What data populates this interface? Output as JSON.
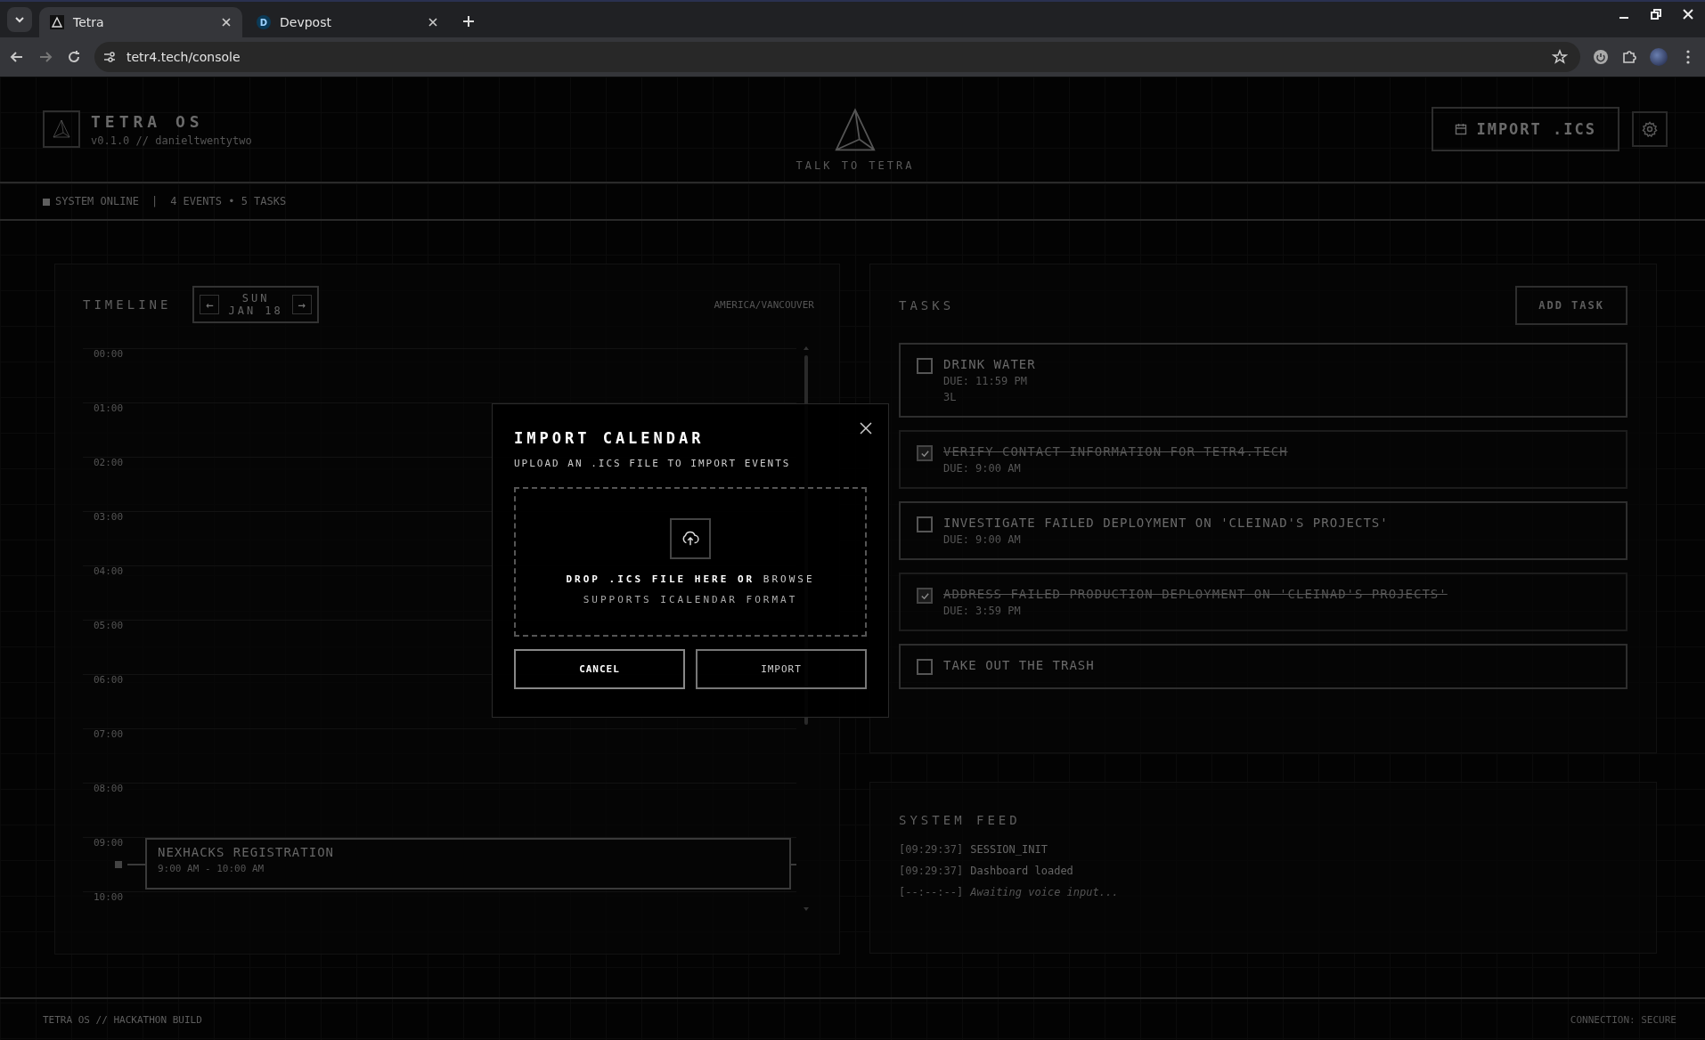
{
  "browser": {
    "tabs": [
      {
        "title": "Tetra",
        "kind": "triangle",
        "selected": true
      },
      {
        "title": "Devpost",
        "kind": "letter",
        "letter": "D",
        "selected": false
      }
    ],
    "url": "tetr4.tech/console"
  },
  "header": {
    "title": "TETRA OS",
    "subtitle": "v0.1.0 // danieltwentytwo",
    "center_label": "TALK TO TETRA",
    "import_button": "IMPORT .ICS"
  },
  "status": {
    "online": "SYSTEM ONLINE",
    "separator": "|",
    "counts": "4 EVENTS • 5 TASKS"
  },
  "timeline": {
    "title": "TIMELINE",
    "day": "SUN",
    "date": "JAN 18",
    "prev": "←",
    "next": "→",
    "timezone": "AMERICA/VANCOUVER",
    "hours": [
      {
        "label": "00:00"
      },
      {
        "label": "01:00"
      },
      {
        "label": "02:00"
      },
      {
        "label": "03:00"
      },
      {
        "label": "04:00"
      },
      {
        "label": "05:00"
      },
      {
        "label": "06:00"
      },
      {
        "label": "07:00"
      },
      {
        "label": "08:00"
      },
      {
        "label": "09:00",
        "events": [
          {
            "title": "NEXHACKS REGISTRATION",
            "time": "9:00 AM - 10:00 AM"
          }
        ]
      },
      {
        "label": "10:00"
      }
    ]
  },
  "tasks": {
    "title": "TASKS",
    "add_button": "ADD TASK",
    "items": [
      {
        "title": "DRINK WATER",
        "due": "DUE: 11:59 PM",
        "note": "3L",
        "checked": false
      },
      {
        "title": "VERIFY CONTACT INFORMATION FOR TETR4.TECH",
        "due": "DUE: 9:00 AM",
        "checked": true
      },
      {
        "title": "INVESTIGATE FAILED DEPLOYMENT ON 'CLEINAD'S PROJECTS'",
        "due": "DUE: 9:00 AM",
        "checked": false
      },
      {
        "title": "ADDRESS FAILED PRODUCTION DEPLOYMENT ON 'CLEINAD'S PROJECTS'",
        "due": "DUE: 3:59 PM",
        "checked": true
      },
      {
        "title": "TAKE OUT THE TRASH",
        "checked": false
      }
    ]
  },
  "feed": {
    "title": "SYSTEM FEED",
    "entries": [
      {
        "time": "[09:29:37]",
        "message": "SESSION_INIT",
        "kind": "log"
      },
      {
        "time": "[09:29:37]",
        "message": "Dashboard loaded",
        "kind": "log"
      },
      {
        "time": "[--:--:--]",
        "message": "Awaiting voice input...",
        "kind": "pending"
      }
    ]
  },
  "modal": {
    "title": "IMPORT CALENDAR",
    "subtitle": "UPLOAD AN .ICS FILE TO IMPORT EVENTS",
    "drop_text": "DROP .ICS FILE HERE OR",
    "browse_link": "BROWSE",
    "hint": "SUPPORTS ICALENDAR FORMAT",
    "cancel_button": "CANCEL",
    "import_button": "IMPORT"
  },
  "footer": {
    "left": "TETRA OS // HACKATHON BUILD",
    "right": "CONNECTION: SECURE"
  }
}
